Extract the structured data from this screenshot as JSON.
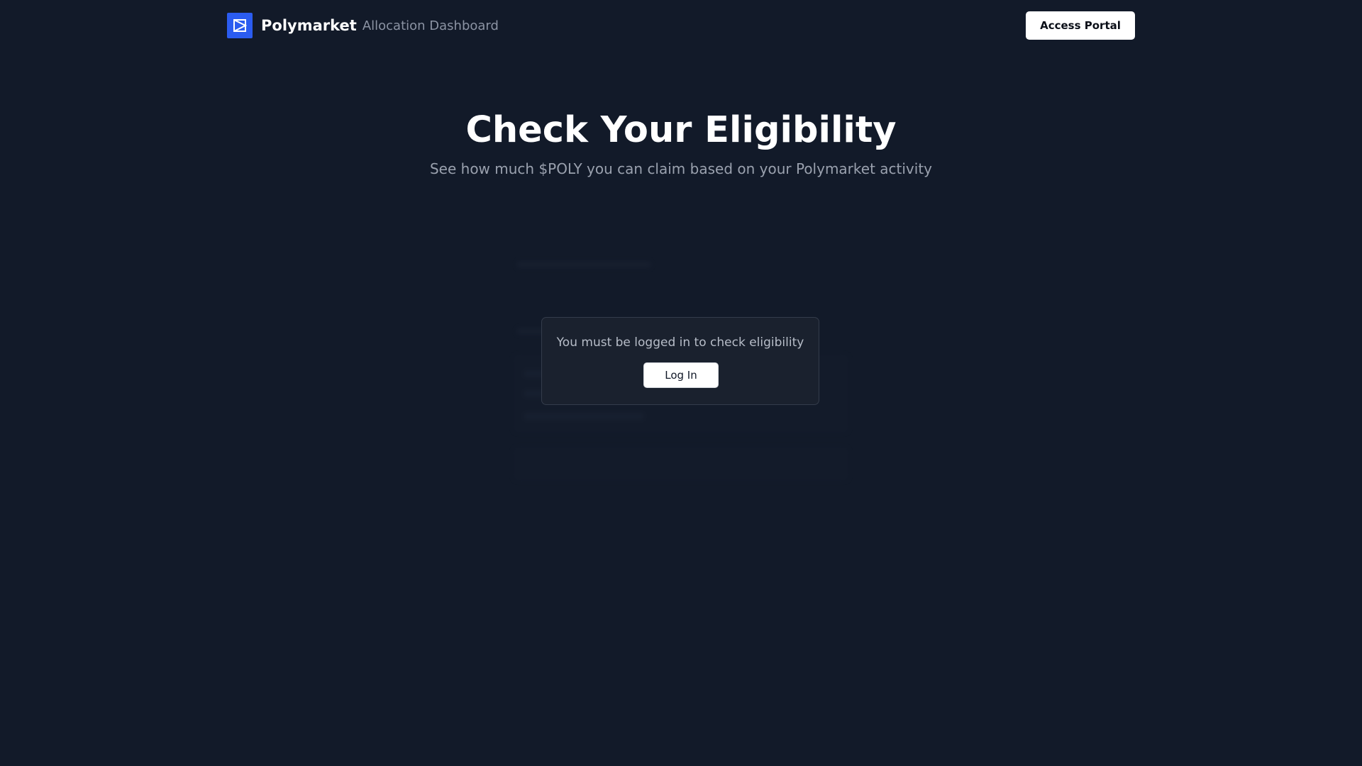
{
  "header": {
    "brand_name": "Polymarket",
    "brand_subtitle": "Allocation Dashboard",
    "access_portal_label": "Access Portal",
    "logo_icon": "polymarket-logo-icon"
  },
  "hero": {
    "title": "Check Your Eligibility",
    "subtitle": "See how much $POLY you can claim based on your Polymarket activity"
  },
  "login_prompt": {
    "message": "You must be logged in to check eligibility",
    "button_label": "Log In"
  },
  "colors": {
    "background": "#121a29",
    "brand_accent": "#2b5cf0",
    "button_bg": "#ffffff"
  }
}
